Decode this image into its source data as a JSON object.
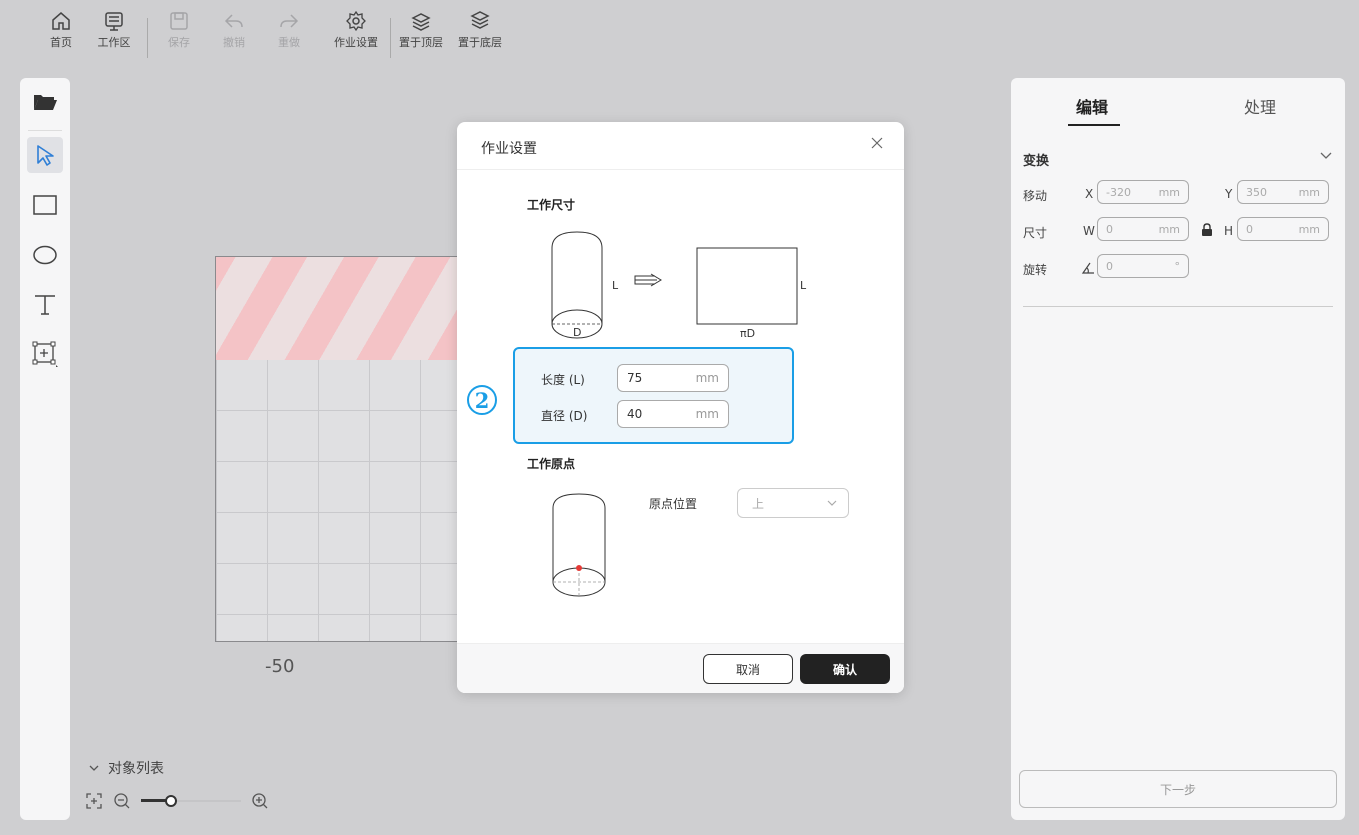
{
  "toolbar_top": {
    "home": "首页",
    "workspace": "工作区",
    "save": "保存",
    "undo": "撤销",
    "redo": "重做",
    "job_settings": "作业设置",
    "bring_to_top": "置于顶层",
    "send_to_bottom": "置于底层"
  },
  "tools": [
    "folder-icon",
    "select-icon",
    "rectangle-icon",
    "ellipse-icon",
    "text-icon",
    "add-frame-icon"
  ],
  "canvas": {
    "axis_label": "-50",
    "object_list_label": "对象列表",
    "zoom_level": 0.3
  },
  "right_panel": {
    "tabs": [
      "编辑",
      "处理"
    ],
    "section_title": "变换",
    "move_label": "移动",
    "x_label": "X",
    "x_value": "-320",
    "y_label": "Y",
    "y_value": "350",
    "size_label": "尺寸",
    "w_label": "W",
    "w_value": "0",
    "h_label": "H",
    "h_value": "0",
    "rotate_label": "旋转",
    "rotate_value": "0",
    "unit_mm": "mm",
    "unit_deg": "°",
    "next_button": "下一步"
  },
  "modal": {
    "title": "作业设置",
    "work_size_title": "工作尺寸",
    "diagram_L": "L",
    "diagram_D": "D",
    "diagram_piD": "πD",
    "step_badge": "2",
    "length_label": "长度 (L)",
    "length_value": "75",
    "diameter_label": "直径 (D)",
    "diameter_value": "40",
    "unit": "mm",
    "origin_title": "工作原点",
    "origin_position_label": "原点位置",
    "origin_position_value": "上",
    "cancel_button": "取消",
    "confirm_button": "确认"
  },
  "colors": {
    "accent_blue": "#1a9ee6",
    "origin_dot": "#e53935",
    "stripe_pink": "#f4c3c6"
  }
}
